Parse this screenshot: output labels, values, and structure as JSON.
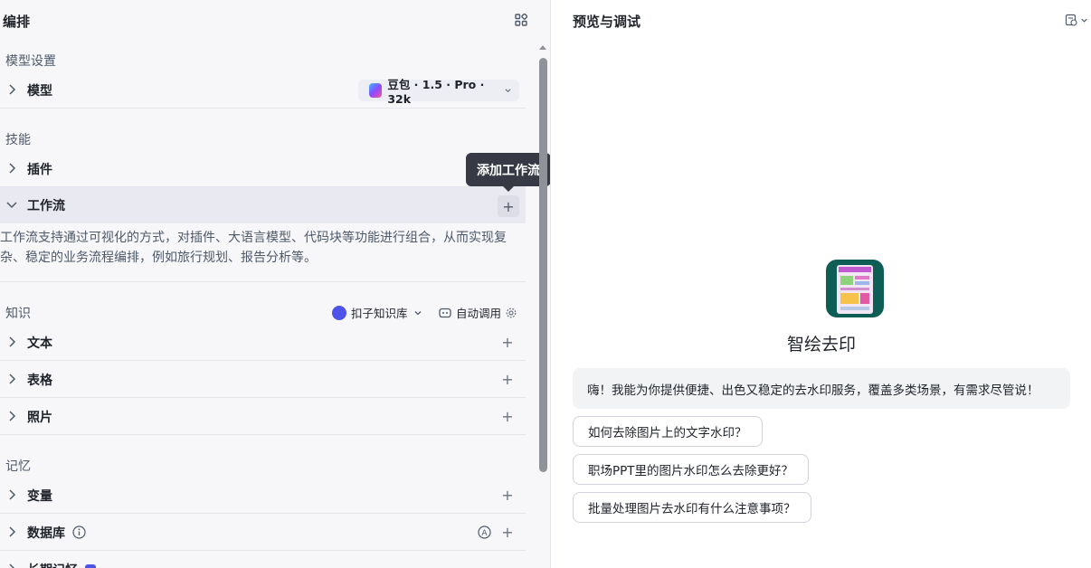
{
  "left_panel": {
    "title": "编排",
    "layout_icon": "grid-icon",
    "sections": {
      "model_settings": "模型设置",
      "skills": "技能",
      "knowledge": "知识",
      "memory": "记忆"
    },
    "model_row": {
      "label": "模型",
      "model_name": "豆包 · 1.5 · Pro · 32k"
    },
    "skills_rows": {
      "plugin": "插件",
      "workflow": "工作流"
    },
    "workflow_desc": "工作流支持通过可视化的方式，对插件、大语言模型、代码块等功能进行组合，从而实现复杂、稳定的业务流程编排，例如旅行规划、报告分析等。",
    "tooltip": "添加工作流",
    "knowledge_source": "扣子知识库",
    "knowledge_mode": "自动调用",
    "knowledge_rows": {
      "text": "文本",
      "table": "表格",
      "photo": "照片"
    },
    "memory_rows": {
      "variable": "变量",
      "database": "数据库",
      "long_term": "长期记忆"
    }
  },
  "right_panel": {
    "title": "预览与调试",
    "bot_name": "智绘去印",
    "greeting": "嗨！我能为你提供便捷、出色又稳定的去水印服务，覆盖多类场景，有需求尽管说！",
    "suggestions": [
      "如何去除图片上的文字水印？",
      "职场PPT里的图片水印怎么去除更好？",
      "批量处理图片去水印有什么注意事项？"
    ]
  },
  "colors": {
    "accent": "#4d53e8",
    "tooltip_bg": "#373a44",
    "bot_avatar_bg": "#0f5e55"
  }
}
